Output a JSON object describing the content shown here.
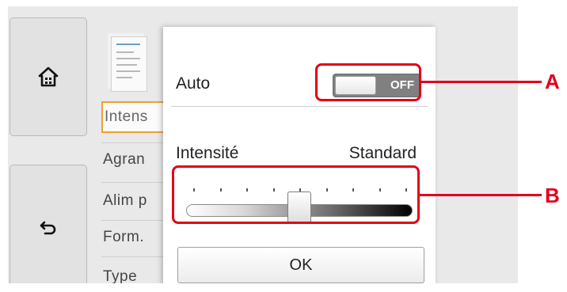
{
  "menu": {
    "items": [
      {
        "label": "Intens"
      },
      {
        "label": "Agran"
      },
      {
        "label": "Alim p"
      },
      {
        "label": "Form."
      },
      {
        "label": "Type"
      }
    ]
  },
  "sidebar": {
    "home_icon": "home-icon",
    "back_icon": "back-arrow-icon"
  },
  "dialog": {
    "auto_label": "Auto",
    "auto_toggle_state": "OFF",
    "intensity_label": "Intensité",
    "intensity_value": "Standard",
    "slider": {
      "tick_count": 9,
      "position": 0.5
    },
    "ok_label": "OK"
  },
  "callouts": {
    "a": "A",
    "b": "B",
    "color": "#e3001b"
  },
  "colors": {
    "selected_border": "#f0a030",
    "toggle_off_bg": "#808080"
  }
}
